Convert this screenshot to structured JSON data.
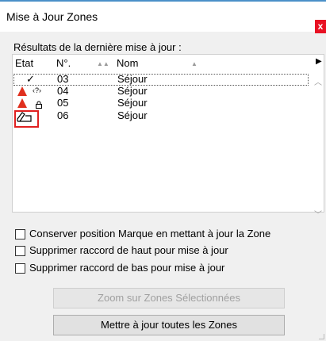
{
  "window": {
    "title": "Mise à Jour Zones",
    "close_glyph": "x"
  },
  "results_label": "Résultats de la dernière mise à jour :",
  "table": {
    "columns": [
      "Etat",
      "N°.",
      "Nom"
    ],
    "rows": [
      {
        "status_icons": [
          "check-icon"
        ],
        "number": "03",
        "name": "Séjour",
        "selected": true
      },
      {
        "status_icons": [
          "warning-icon",
          "unknown-icon"
        ],
        "unknown_glyph": "‹?›",
        "number": "04",
        "name": "Séjour"
      },
      {
        "status_icons": [
          "warning-icon",
          "lock-icon"
        ],
        "number": "05",
        "name": "Séjour"
      },
      {
        "status_icons": [
          "edit-zone-icon"
        ],
        "number": "06",
        "name": "Séjour",
        "highlighted": true
      }
    ]
  },
  "options": [
    {
      "label": "Conserver position Marque en mettant à jour la Zone",
      "checked": false
    },
    {
      "label": "Supprimer raccord de haut pour mise à jour",
      "checked": false
    },
    {
      "label": "Supprimer raccord de bas pour mise à jour",
      "checked": false
    }
  ],
  "buttons": {
    "zoom_label": "Zoom sur Zones Sélectionnées",
    "zoom_enabled": false,
    "update_all_label": "Mettre à jour toutes les Zones"
  },
  "colors": {
    "accent": "#4a90c8",
    "close": "#e81123",
    "warning": "#e0301e",
    "highlight_box": "#e02020"
  }
}
